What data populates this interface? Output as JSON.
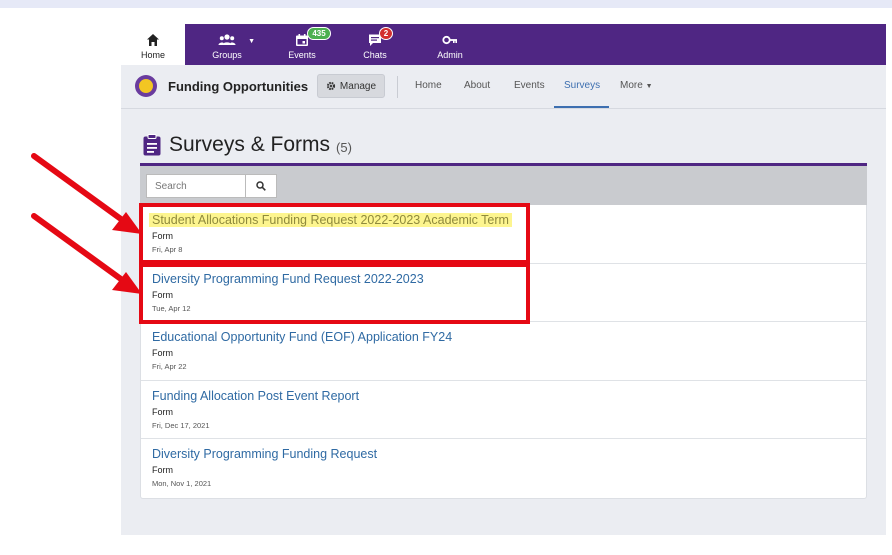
{
  "topnav": {
    "items": [
      {
        "label": "Home",
        "icon": "home-icon"
      },
      {
        "label": "Groups",
        "icon": "groups-icon"
      },
      {
        "label": "Events",
        "icon": "calendar-icon",
        "badge": "435"
      },
      {
        "label": "Chats",
        "icon": "chat-icon",
        "badge": "2"
      },
      {
        "label": "Admin",
        "icon": "key-icon"
      }
    ]
  },
  "org": {
    "name": "Funding Opportunities",
    "manage_label": "Manage",
    "tabs": [
      "Home",
      "About",
      "Events",
      "Surveys",
      "More"
    ],
    "active_tab": "Surveys"
  },
  "page": {
    "title": "Surveys & Forms",
    "count": "(5)"
  },
  "search": {
    "placeholder": "Search"
  },
  "forms": [
    {
      "title": "Student Allocations Funding Request 2022-2023 Academic Term",
      "type": "Form",
      "date": "Fri, Apr 8"
    },
    {
      "title": "Diversity Programming Fund Request 2022-2023",
      "type": "Form",
      "date": "Tue, Apr 12"
    },
    {
      "title": "Educational Opportunity Fund (EOF) Application FY24",
      "type": "Form",
      "date": "Fri, Apr 22"
    },
    {
      "title": "Funding Allocation Post Event Report",
      "type": "Form",
      "date": "Fri, Dec 17, 2021"
    },
    {
      "title": "Diversity Programming Funding Request",
      "type": "Form",
      "date": "Mon, Nov 1, 2021"
    }
  ],
  "colors": {
    "brand_purple": "#4f2683",
    "link_blue": "#2f6aa3",
    "highlight_yellow": "#fdf58f",
    "annotation_red": "#e50914",
    "badge_green": "#4caf50",
    "badge_red": "#d32f2f"
  }
}
